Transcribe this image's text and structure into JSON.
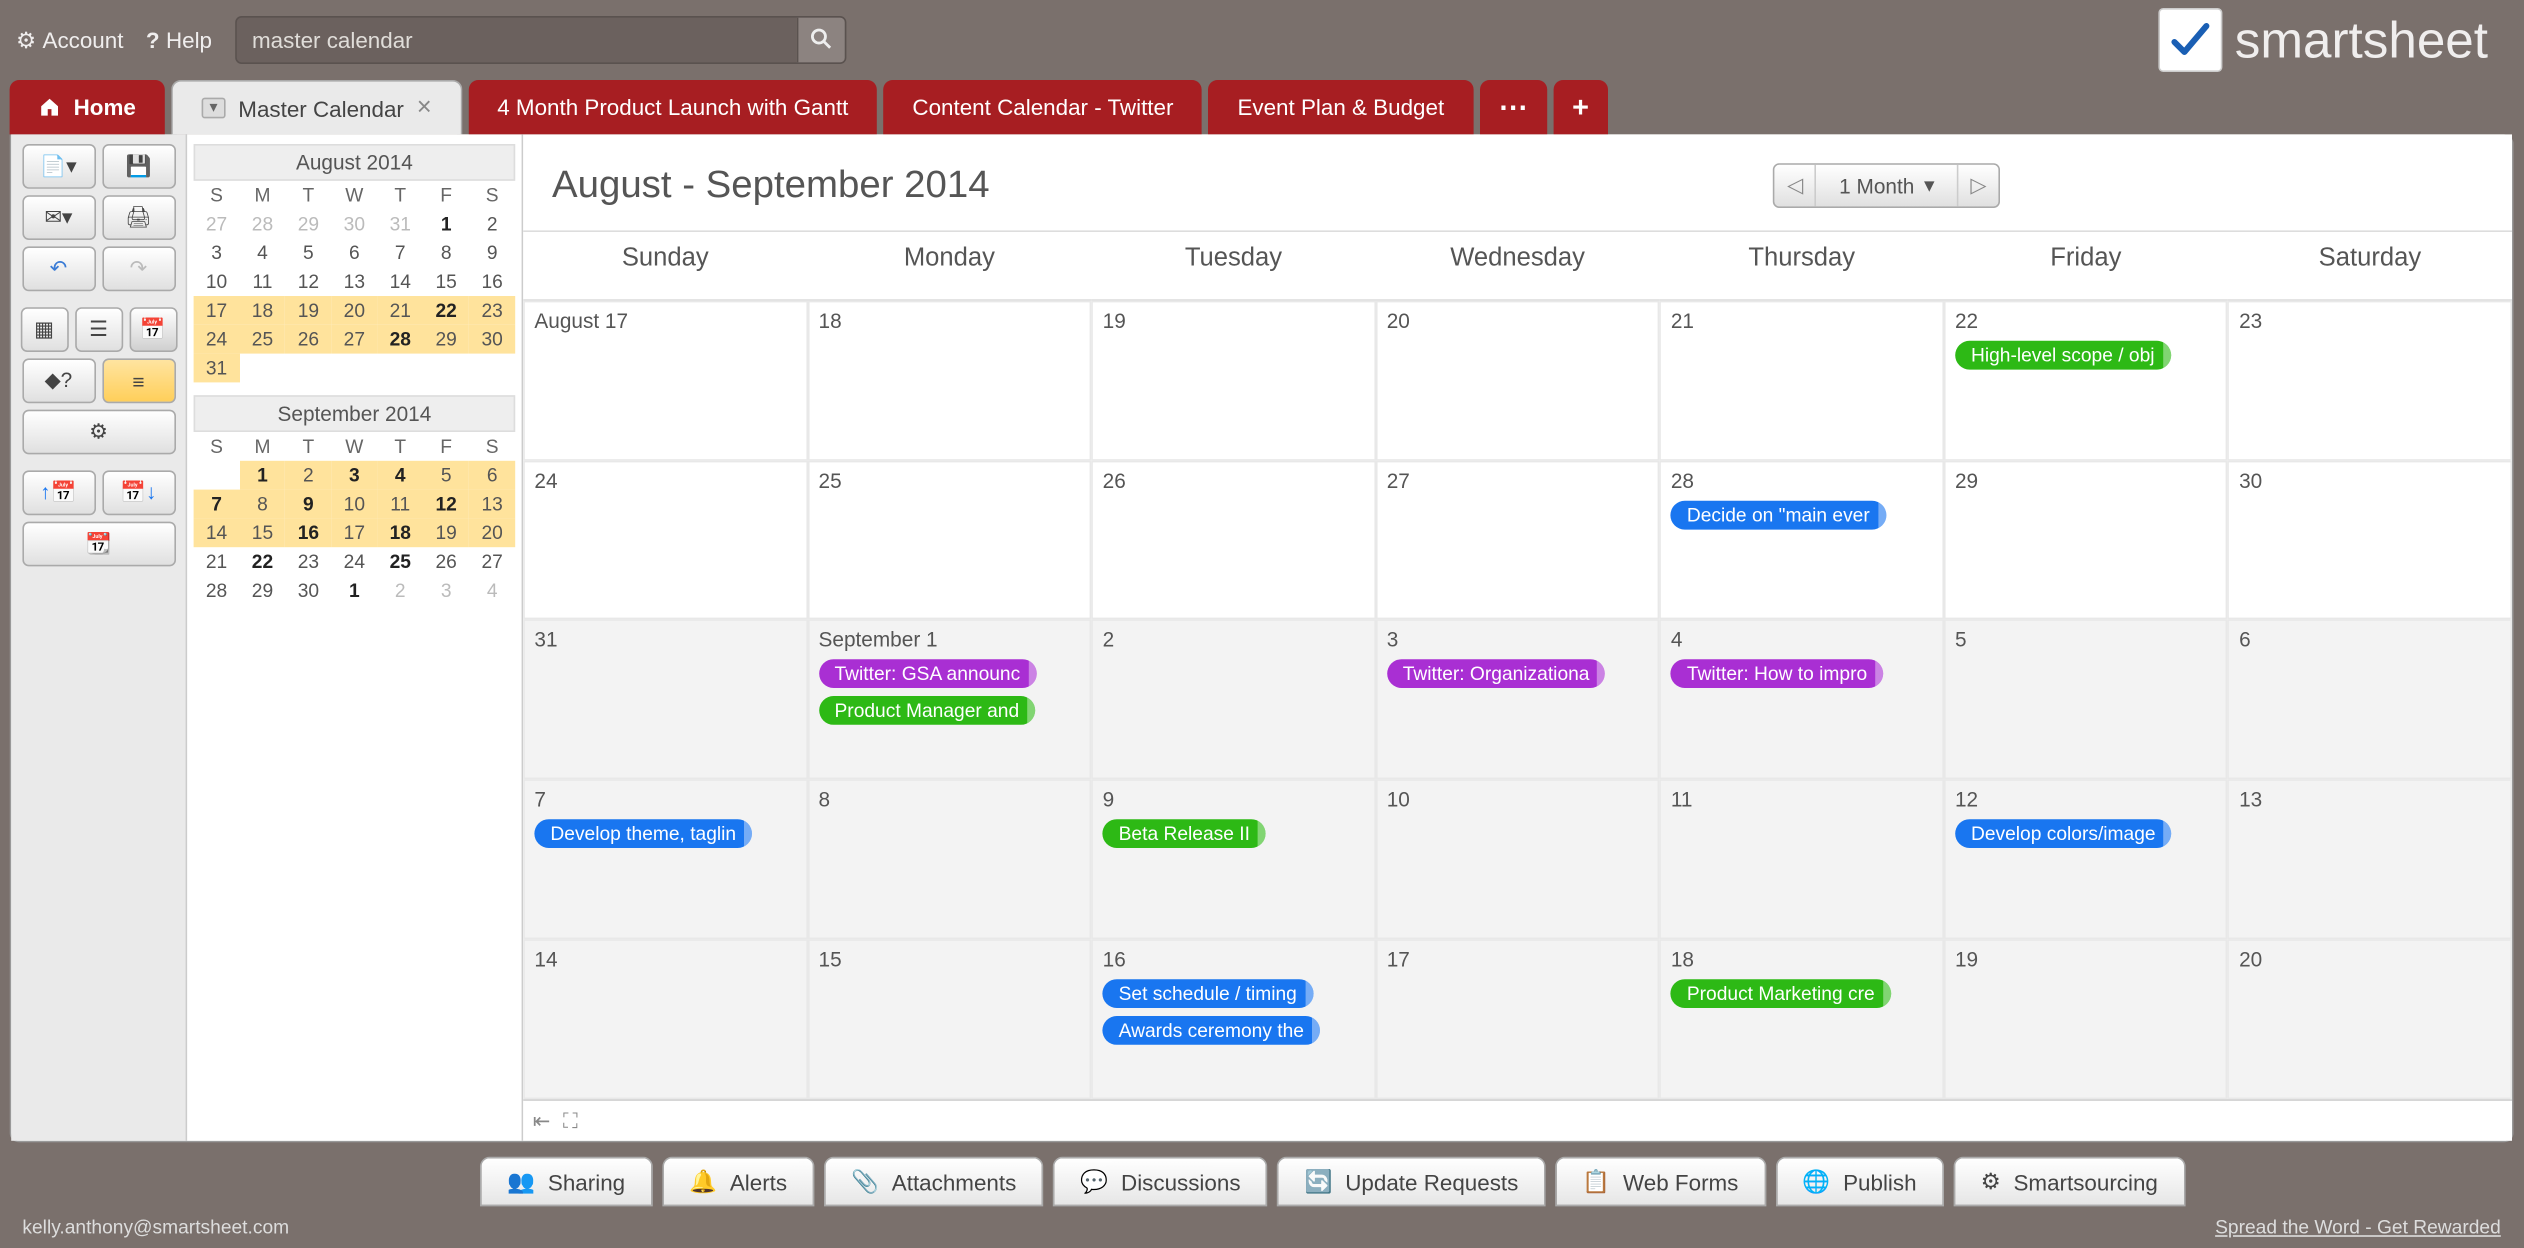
{
  "topbar": {
    "account": "Account",
    "help": "Help",
    "search_value": "master calendar",
    "brand": "smartsheet"
  },
  "tabs": {
    "home": "Home",
    "active": "Master Calendar",
    "others": [
      "4 Month Product Launch with Gantt",
      "Content Calendar - Twitter",
      "Event Plan & Budget"
    ]
  },
  "minicals": [
    {
      "title": "August 2014",
      "dow": [
        "S",
        "M",
        "T",
        "W",
        "T",
        "F",
        "S"
      ],
      "rows": [
        [
          {
            "n": "27",
            "dim": true
          },
          {
            "n": "28",
            "dim": true
          },
          {
            "n": "29",
            "dim": true
          },
          {
            "n": "30",
            "dim": true
          },
          {
            "n": "31",
            "dim": true
          },
          {
            "n": "1",
            "bold": true
          },
          {
            "n": "2"
          }
        ],
        [
          {
            "n": "3"
          },
          {
            "n": "4"
          },
          {
            "n": "5"
          },
          {
            "n": "6"
          },
          {
            "n": "7"
          },
          {
            "n": "8"
          },
          {
            "n": "9"
          }
        ],
        [
          {
            "n": "10"
          },
          {
            "n": "11"
          },
          {
            "n": "12"
          },
          {
            "n": "13"
          },
          {
            "n": "14"
          },
          {
            "n": "15"
          },
          {
            "n": "16"
          }
        ],
        [
          {
            "n": "17",
            "hl": true
          },
          {
            "n": "18",
            "hl": true
          },
          {
            "n": "19",
            "hl": true
          },
          {
            "n": "20",
            "hl": true
          },
          {
            "n": "21",
            "hl": true
          },
          {
            "n": "22",
            "hl": true,
            "bold": true
          },
          {
            "n": "23",
            "hl": true
          }
        ],
        [
          {
            "n": "24",
            "hl": true
          },
          {
            "n": "25",
            "hl": true
          },
          {
            "n": "26",
            "hl": true
          },
          {
            "n": "27",
            "hl": true
          },
          {
            "n": "28",
            "hl": true,
            "bold": true
          },
          {
            "n": "29",
            "hl": true
          },
          {
            "n": "30",
            "hl": true
          }
        ],
        [
          {
            "n": "31",
            "hl": true
          },
          {
            "n": ""
          },
          {
            "n": ""
          },
          {
            "n": ""
          },
          {
            "n": ""
          },
          {
            "n": ""
          },
          {
            "n": ""
          }
        ]
      ]
    },
    {
      "title": "September 2014",
      "dow": [
        "S",
        "M",
        "T",
        "W",
        "T",
        "F",
        "S"
      ],
      "rows": [
        [
          {
            "n": ""
          },
          {
            "n": "1",
            "hl": true,
            "bold": true
          },
          {
            "n": "2",
            "hl": true
          },
          {
            "n": "3",
            "hl": true,
            "bold": true
          },
          {
            "n": "4",
            "hl": true,
            "bold": true
          },
          {
            "n": "5",
            "hl": true
          },
          {
            "n": "6",
            "hl": true
          }
        ],
        [
          {
            "n": "7",
            "hl": true,
            "bold": true
          },
          {
            "n": "8",
            "hl": true
          },
          {
            "n": "9",
            "hl": true,
            "bold": true
          },
          {
            "n": "10",
            "hl": true
          },
          {
            "n": "11",
            "hl": true
          },
          {
            "n": "12",
            "hl": true,
            "bold": true
          },
          {
            "n": "13",
            "hl": true
          }
        ],
        [
          {
            "n": "14",
            "hl": true
          },
          {
            "n": "15",
            "hl": true
          },
          {
            "n": "16",
            "hl": true,
            "bold": true
          },
          {
            "n": "17",
            "hl": true
          },
          {
            "n": "18",
            "hl": true,
            "bold": true
          },
          {
            "n": "19",
            "hl": true
          },
          {
            "n": "20",
            "hl": true
          }
        ],
        [
          {
            "n": "21"
          },
          {
            "n": "22",
            "bold": true
          },
          {
            "n": "23"
          },
          {
            "n": "24"
          },
          {
            "n": "25",
            "bold": true
          },
          {
            "n": "26"
          },
          {
            "n": "27"
          }
        ],
        [
          {
            "n": "28"
          },
          {
            "n": "29"
          },
          {
            "n": "30"
          },
          {
            "n": "1",
            "dim": true,
            "bold": true
          },
          {
            "n": "2",
            "dim": true
          },
          {
            "n": "3",
            "dim": true
          },
          {
            "n": "4",
            "dim": true
          }
        ]
      ]
    }
  ],
  "calendar": {
    "title": "August - September 2014",
    "range_label": "1 Month",
    "dow": [
      "Sunday",
      "Monday",
      "Tuesday",
      "Wednesday",
      "Thursday",
      "Friday",
      "Saturday"
    ],
    "weeks": [
      [
        {
          "label": "August 17"
        },
        {
          "label": "18"
        },
        {
          "label": "19"
        },
        {
          "label": "20"
        },
        {
          "label": "21"
        },
        {
          "label": "22",
          "events": [
            {
              "text": "High-level scope / obj",
              "color": "green"
            }
          ]
        },
        {
          "label": "23"
        }
      ],
      [
        {
          "label": "24"
        },
        {
          "label": "25"
        },
        {
          "label": "26"
        },
        {
          "label": "27"
        },
        {
          "label": "28",
          "events": [
            {
              "text": "Decide on \"main ever",
              "color": "blue"
            }
          ]
        },
        {
          "label": "29"
        },
        {
          "label": "30"
        }
      ],
      [
        {
          "label": "31",
          "shade": true
        },
        {
          "label": "September 1",
          "shade": true,
          "events": [
            {
              "text": "Twitter: GSA announc",
              "color": "purple"
            },
            {
              "text": "Product Manager and",
              "color": "green"
            }
          ]
        },
        {
          "label": "2",
          "shade": true
        },
        {
          "label": "3",
          "shade": true,
          "events": [
            {
              "text": "Twitter: Organizationa",
              "color": "purple"
            }
          ]
        },
        {
          "label": "4",
          "shade": true,
          "events": [
            {
              "text": "Twitter: How to impro",
              "color": "purple"
            }
          ]
        },
        {
          "label": "5",
          "shade": true
        },
        {
          "label": "6",
          "shade": true
        }
      ],
      [
        {
          "label": "7",
          "shade": true,
          "events": [
            {
              "text": "Develop theme, taglin",
              "color": "blue"
            }
          ]
        },
        {
          "label": "8",
          "shade": true
        },
        {
          "label": "9",
          "shade": true,
          "events": [
            {
              "text": "Beta Release II",
              "color": "green"
            }
          ]
        },
        {
          "label": "10",
          "shade": true
        },
        {
          "label": "11",
          "shade": true
        },
        {
          "label": "12",
          "shade": true,
          "events": [
            {
              "text": "Develop colors/image",
              "color": "blue"
            }
          ]
        },
        {
          "label": "13",
          "shade": true
        }
      ],
      [
        {
          "label": "14",
          "shade": true
        },
        {
          "label": "15",
          "shade": true
        },
        {
          "label": "16",
          "shade": true,
          "events": [
            {
              "text": "Set schedule / timing",
              "color": "blue"
            },
            {
              "text": "Awards ceremony the",
              "color": "blue"
            }
          ]
        },
        {
          "label": "17",
          "shade": true
        },
        {
          "label": "18",
          "shade": true,
          "events": [
            {
              "text": "Product Marketing cre",
              "color": "green"
            }
          ]
        },
        {
          "label": "19",
          "shade": true
        },
        {
          "label": "20",
          "shade": true
        }
      ]
    ]
  },
  "bottom_tabs": [
    "Sharing",
    "Alerts",
    "Attachments",
    "Discussions",
    "Update Requests",
    "Web Forms",
    "Publish",
    "Smartsourcing"
  ],
  "footer": {
    "left": "kelly.anthony@smartsheet.com",
    "right": "Spread the Word - Get Rewarded"
  }
}
